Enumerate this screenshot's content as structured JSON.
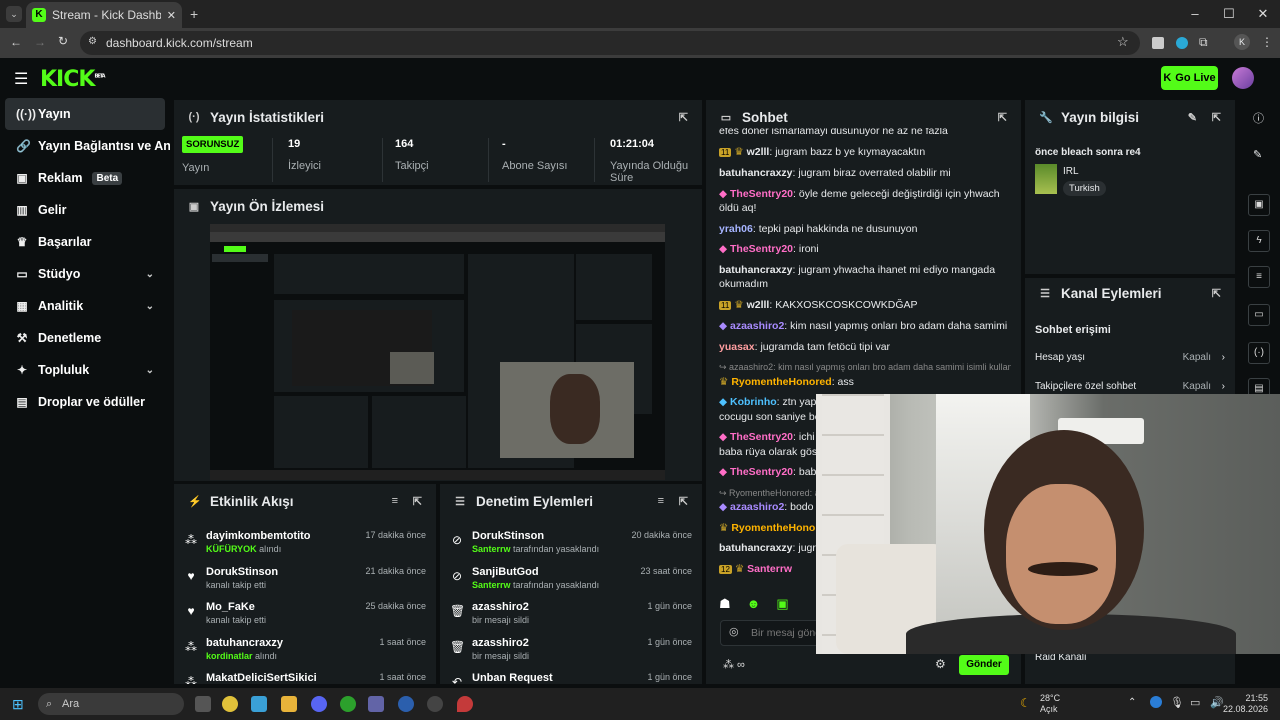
{
  "browser": {
    "tab_title": "Stream - Kick Dashboard",
    "url": "dashboard.kick.com/stream",
    "tab_icon": "K"
  },
  "header": {
    "logo": "KICK",
    "logo_beta": "BETA",
    "go_live": "Go Live"
  },
  "sidebar": {
    "items": [
      {
        "label": "Yayın"
      },
      {
        "label": "Yayın Bağlantısı ve Anahtarı"
      },
      {
        "label": "Reklam",
        "badge": "Beta"
      },
      {
        "label": "Gelir"
      },
      {
        "label": "Başarılar"
      },
      {
        "label": "Stüdyo"
      },
      {
        "label": "Analitik"
      },
      {
        "label": "Denetleme"
      },
      {
        "label": "Topluluk"
      },
      {
        "label": "Droplar ve ödüller"
      }
    ]
  },
  "stats": {
    "title": "Yayın İstatistikleri",
    "status": "SORUNSUZ",
    "status_label": "Yayın",
    "viewers": "19",
    "viewers_label": "İzleyici",
    "followers": "164",
    "followers_label": "Takipçi",
    "subs": "-",
    "subs_label": "Abone Sayısı",
    "uptime": "01:21:04",
    "uptime_label": "Yayında Olduğu Süre"
  },
  "preview": {
    "title": "Yayın Ön İzlemesi"
  },
  "activity": {
    "title": "Etkinlik Akışı",
    "items": [
      {
        "name": "dayimkombemtotito",
        "sub_bold": "KÜFÜRYOK",
        "sub": " alındı",
        "time": "17 dakika önce"
      },
      {
        "name": "DorukStinson",
        "sub_bold": "",
        "sub": "kanalı takip etti",
        "time": "21 dakika önce"
      },
      {
        "name": "Mo_FaKe",
        "sub_bold": "",
        "sub": "kanalı takip etti",
        "time": "25 dakika önce"
      },
      {
        "name": "batuhancraxzy",
        "sub_bold": "kordinatlar",
        "sub": " alındı",
        "time": "1 saat önce"
      },
      {
        "name": "MakatDeliciSertSikici",
        "sub_bold": "",
        "sub": "",
        "time": "1 saat önce"
      }
    ]
  },
  "moderation": {
    "title": "Denetim Eylemleri",
    "items": [
      {
        "name": "DorukStinson",
        "sub_bold": "Santerrw",
        "sub": " tarafından yasaklandı",
        "time": "20 dakika önce"
      },
      {
        "name": "SanjiButGod",
        "sub_bold": "Santerrw",
        "sub": " tarafından yasaklandı",
        "time": "23 saat önce"
      },
      {
        "name": "azasshiro2",
        "sub_bold": "",
        "sub": "bir mesajı sildi",
        "time": "1 gün önce"
      },
      {
        "name": "azasshiro2",
        "sub_bold": "",
        "sub": "bir mesajı sildi",
        "time": "1 gün önce"
      },
      {
        "name": "Unban Request",
        "sub_bold": "",
        "sub": "",
        "time": "1 gün önce"
      }
    ]
  },
  "chat": {
    "title": "Sohbet",
    "messages": [
      {
        "user": "",
        "color": "#e8eaec",
        "text": "efes doner ismarlamayi dusunuyor ne az ne fazla"
      },
      {
        "user": "w2lll",
        "color": "#ffffff",
        "text": "jugram bazz b ye kıymayacaktın"
      },
      {
        "user": "batuhancraxzy",
        "color": "#ffffff",
        "text": "jugram biraz overrated olabilir mi"
      },
      {
        "user": "TheSentry20",
        "color": "#ff6ec7",
        "text": "öyle deme geleceği değiştirdiği için yhwach öldü aq!"
      },
      {
        "user": "yrah06",
        "color": "#a6b4ff",
        "text": "tepki papi hakkinda ne dusunuyon"
      },
      {
        "user": "TheSentry20",
        "color": "#ff6ec7",
        "text": "ironi"
      },
      {
        "user": "batuhancraxzy",
        "color": "#ffffff",
        "text": "jugram yhwacha ihanet mi ediyo mangada okumadım"
      },
      {
        "user": "w2lll",
        "color": "#ffffff",
        "text": "KAKXOSKCOSKCOWKDĞAP"
      },
      {
        "user": "azaashiro2",
        "color": "#a98bff",
        "text": "kim nasıl yapmış onları bro adam daha samimi"
      },
      {
        "user": "yuasax",
        "color": "#ff9ea0",
        "text": "jugramda tam fetöcü tipi var"
      },
      {
        "user": "RyomentheHonored",
        "color": "#ffb400",
        "text": "ass"
      },
      {
        "user": "Kobrinho",
        "color": "#4ec1ff",
        "text": "ztn yap"
      },
      {
        "user": "TheSentry20",
        "color": "#ff6ec7",
        "text": "ichi"
      },
      {
        "user": "TheSentry20",
        "color": "#ff6ec7",
        "text": "bab"
      },
      {
        "user": "azaashiro2",
        "color": "#a98bff",
        "text": "bodo"
      },
      {
        "user": "RyomentheHonor",
        "color": "#ffb400",
        "text": ""
      },
      {
        "user": "batuhancraxzy",
        "color": "#ffffff",
        "text": "jugra"
      },
      {
        "user": "Santerrw",
        "color": "#ff6ec7",
        "text": ""
      }
    ],
    "system_reply": "azaashiro2: kim nasıl yapmış onları bro adam daha samimi isimli kullan...",
    "system_reply2": "RyomentheHonored: ass",
    "cont1": "cocugu son saniye be",
    "cont2": "baba rüya olarak göst",
    "placeholder": "Bir mesaj gönd",
    "send": "Gönder"
  },
  "stream_info": {
    "title": "Yayın bilgisi",
    "stream_title": "önce bleach sonra re4",
    "category": "IRL",
    "language": "Turkish"
  },
  "channel_actions": {
    "title": "Kanal Eylemleri",
    "section": "Sohbet erişimi",
    "rows": [
      {
        "label": "Hesap yaşı",
        "value": "Kapalı"
      },
      {
        "label": "Takipçilere özel sohbet",
        "value": "Kapalı"
      }
    ],
    "raid": "Raid Kanalı"
  },
  "taskbar": {
    "search": "Ara",
    "temp": "28°C",
    "weather": "Açık",
    "time": "21:55",
    "date": "22.08.2026"
  },
  "colors": {
    "accent": "#53fc18",
    "panel": "#171c1e",
    "bg": "#0b0e0f"
  }
}
